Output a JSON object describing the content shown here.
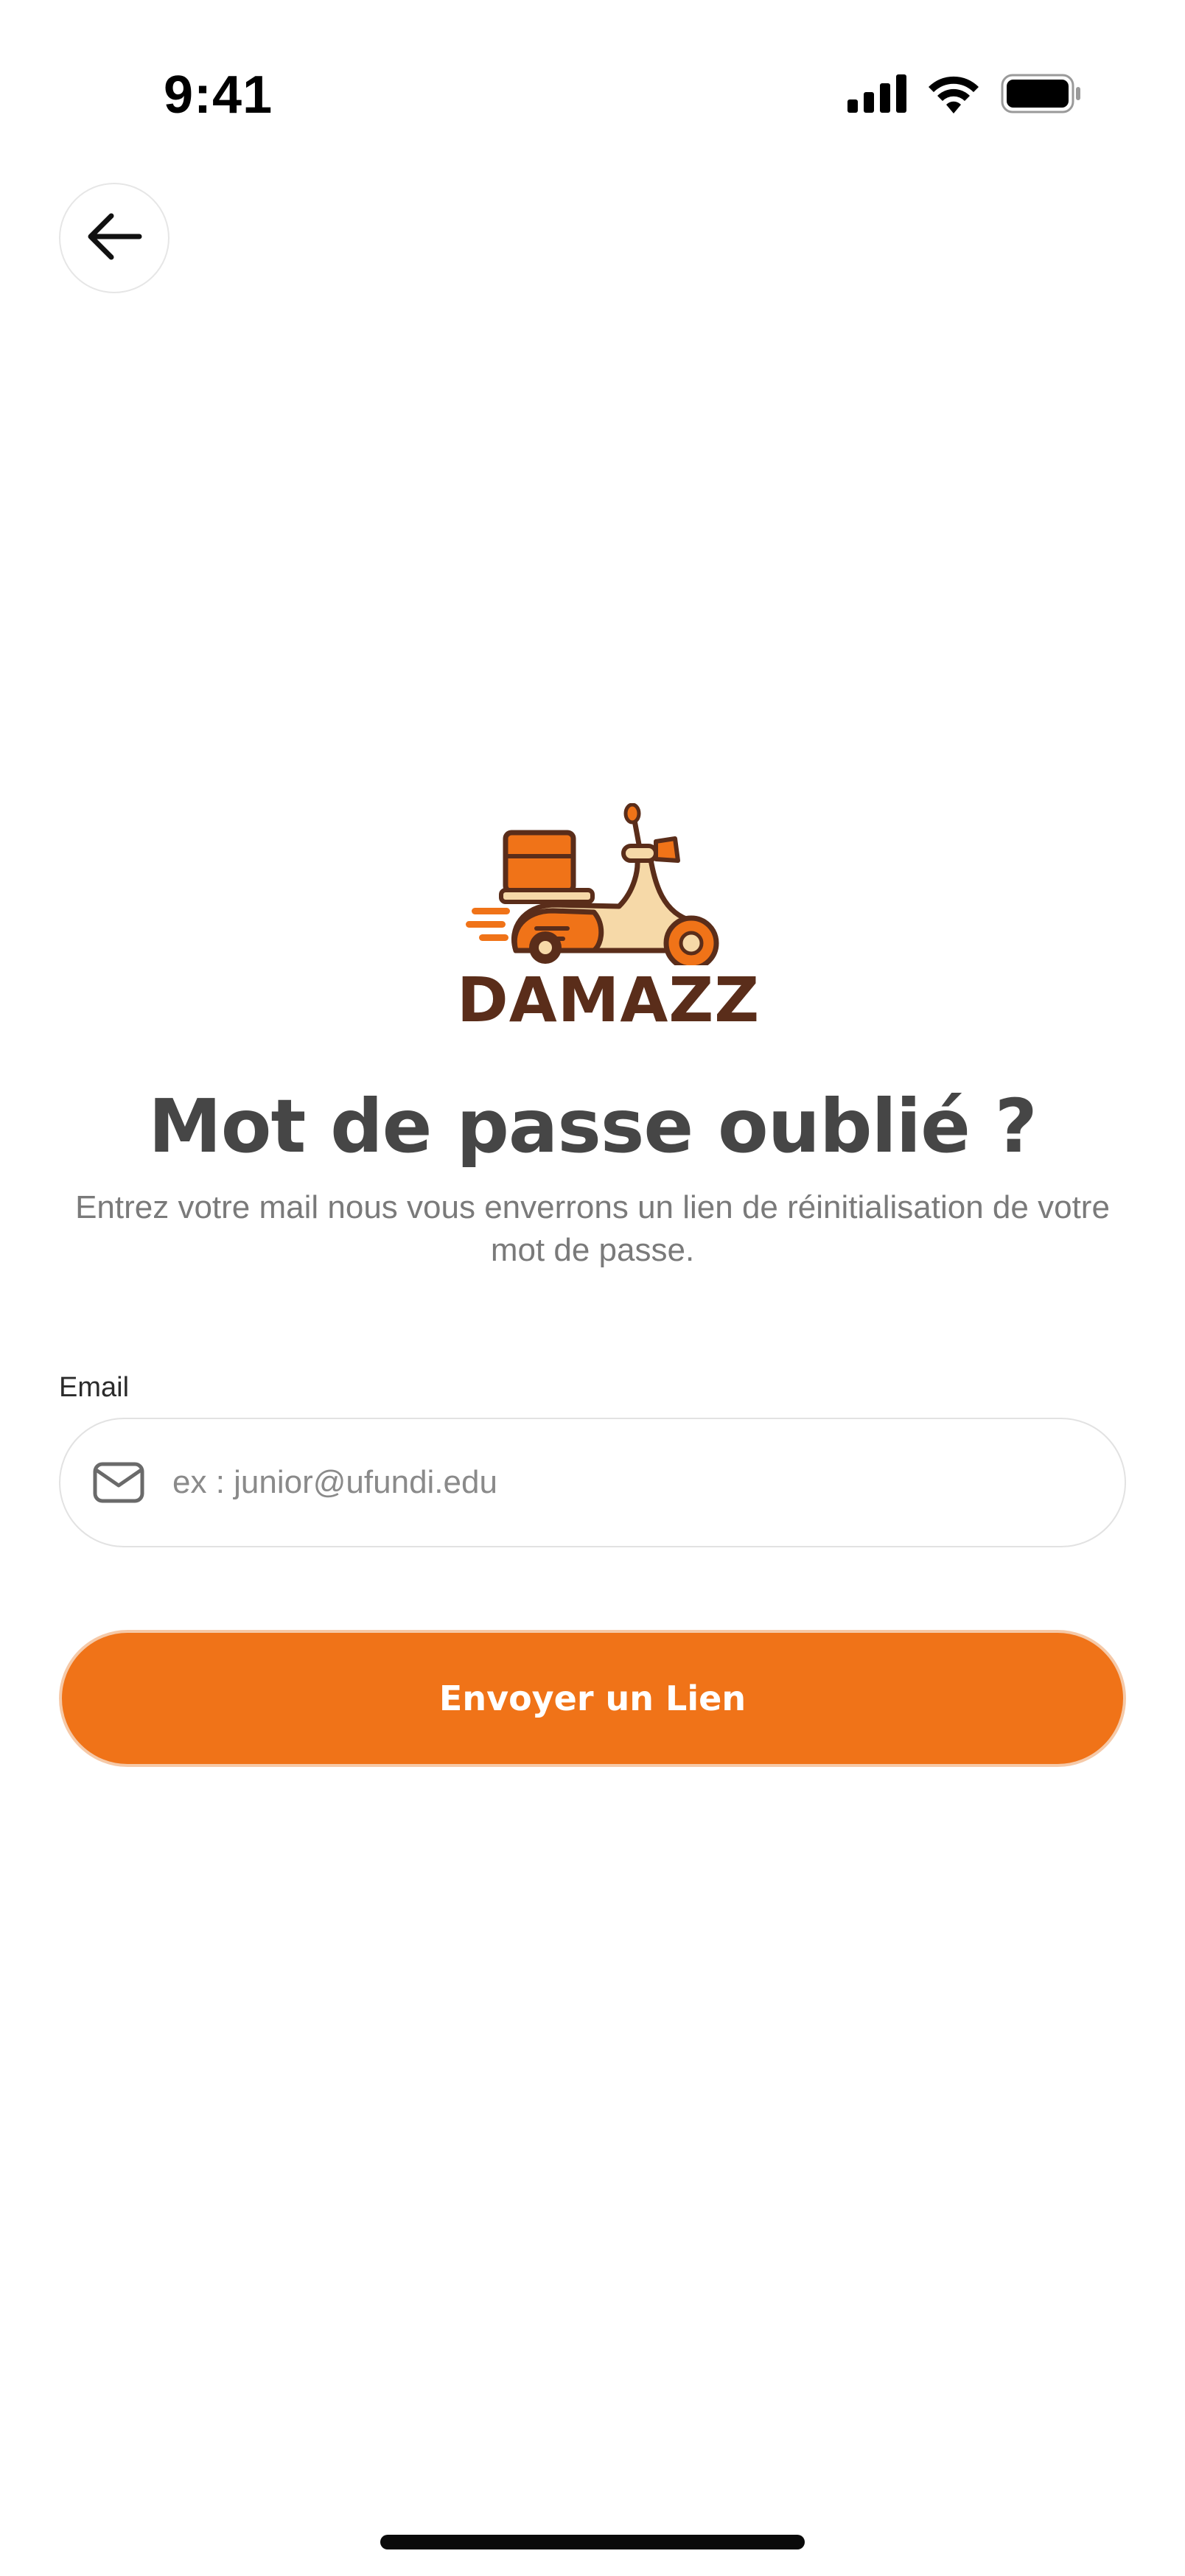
{
  "status_bar": {
    "time": "9:41",
    "icons": [
      "cellular-signal-icon",
      "wifi-icon",
      "battery-icon"
    ]
  },
  "header": {
    "back_icon": "arrow-left-icon"
  },
  "brand": {
    "name": "DAMAZZ",
    "logo_icon": "scooter-delivery-icon",
    "colors": {
      "orange": "#f07318",
      "brown": "#5a2d1a",
      "cream": "#f6d9a8"
    }
  },
  "main": {
    "title": "Mot de passe oublié ?",
    "subtitle": "Entrez votre mail nous vous enverrons un lien de réinitialisation de votre mot de passe.",
    "email": {
      "label": "Email",
      "placeholder": "ex : junior@ufundi.edu",
      "value": "",
      "icon": "mail-icon"
    },
    "submit_label": "Envoyer un Lien"
  },
  "theme": {
    "accent": "#f07318",
    "title_color": "#464646",
    "subtitle_color": "#7a7a7a",
    "border_color": "#e2e2e2"
  }
}
